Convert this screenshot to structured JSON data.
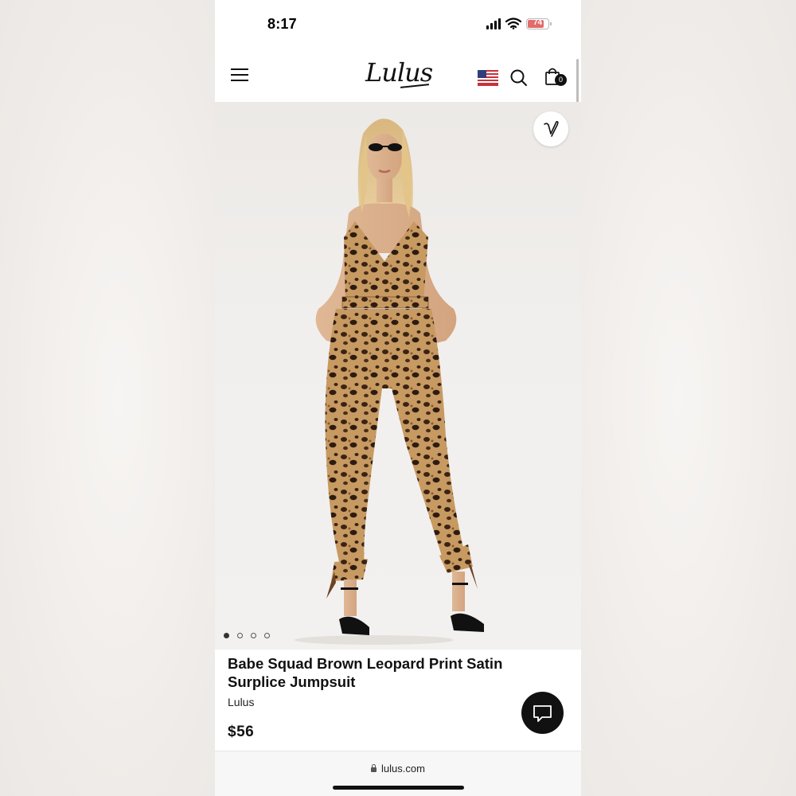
{
  "status_bar": {
    "time": "8:17",
    "battery": "74"
  },
  "header": {
    "logo": "Lulus",
    "cart_count": "0"
  },
  "icons": {
    "menu": "hamburger-menu-icon",
    "flag": "us-flag-icon",
    "search": "search-icon",
    "bag": "shopping-bag-icon",
    "wishlist": "heart-icon",
    "chat": "chat-icon",
    "lock": "lock-icon"
  },
  "gallery": {
    "total_images": 4,
    "active_index": 0
  },
  "product": {
    "title": "Babe Squad Brown Leopard Print Satin Surplice Jumpsuit",
    "brand": "Lulus",
    "price": "$56"
  },
  "browser": {
    "url": "lulus.com"
  },
  "colors": {
    "accent": "#111111",
    "battery_low": "#e36b6b",
    "page_bg": "#ffffff"
  }
}
